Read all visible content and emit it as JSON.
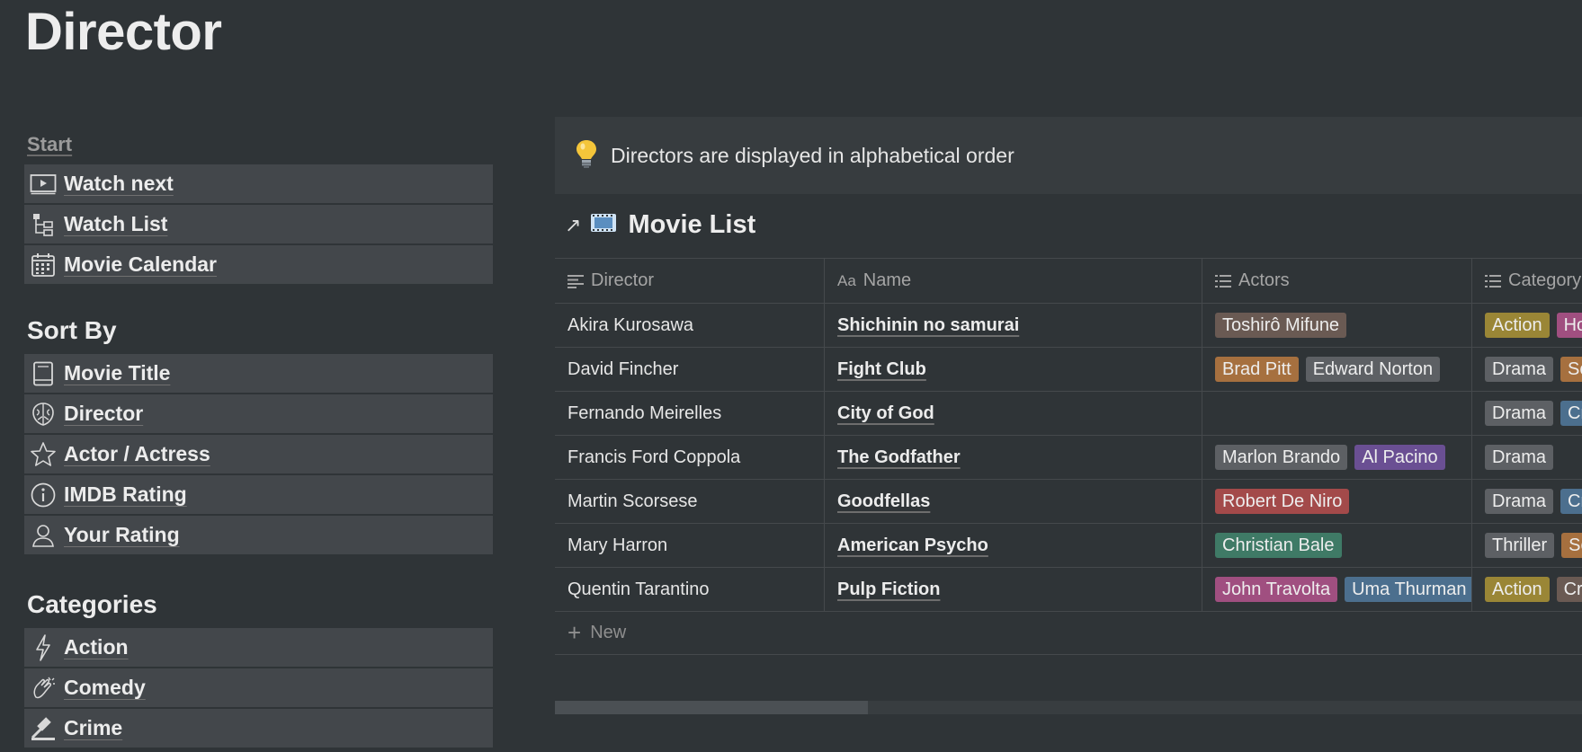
{
  "page": {
    "title": "Director"
  },
  "nav": {
    "start_label": "Start",
    "start_items": [
      {
        "label": "Watch next",
        "icon": "play-screen-icon"
      },
      {
        "label": "Watch List",
        "icon": "tree-list-icon"
      },
      {
        "label": "Movie Calendar",
        "icon": "calendar-icon"
      }
    ],
    "sort_heading": "Sort By",
    "sort_items": [
      {
        "label": "Movie Title",
        "icon": "book-icon"
      },
      {
        "label": "Director",
        "icon": "brain-icon"
      },
      {
        "label": "Actor / Actress",
        "icon": "star-icon"
      },
      {
        "label": "IMDB Rating",
        "icon": "info-icon"
      },
      {
        "label": "Your Rating",
        "icon": "person-icon"
      }
    ],
    "categories_heading": "Categories",
    "category_items": [
      {
        "label": "Action",
        "icon": "lightning-icon"
      },
      {
        "label": "Comedy",
        "icon": "clapping-icon"
      },
      {
        "label": "Crime",
        "icon": "gavel-icon"
      }
    ]
  },
  "callout": {
    "text": "Directors are displayed in alphabetical order"
  },
  "database": {
    "title": "Movie List",
    "columns": {
      "director": "Director",
      "name": "Name",
      "actors": "Actors",
      "category": "Category"
    },
    "rows": [
      {
        "director": "Akira Kurosawa",
        "name": "Shichinin no samurai",
        "actors": [
          {
            "text": "Toshirô Mifune",
            "color": "#6a5a53"
          }
        ],
        "categories": [
          {
            "text": "Action",
            "color": "#9a8636"
          },
          {
            "text": "Horror",
            "color": "#a04f80"
          }
        ]
      },
      {
        "director": "David Fincher",
        "name": "Fight Club",
        "actors": [
          {
            "text": "Brad Pitt",
            "color": "#a6703f"
          },
          {
            "text": "Edward Norton",
            "color": "#5d6064"
          }
        ],
        "categories": [
          {
            "text": "Drama",
            "color": "#5d6064"
          },
          {
            "text": "Sci-Fi",
            "color": "#a6703f"
          }
        ]
      },
      {
        "director": "Fernando Meirelles",
        "name": "City of God",
        "actors": [],
        "categories": [
          {
            "text": "Drama",
            "color": "#5d6064"
          },
          {
            "text": "Crime",
            "color": "#4c6f8e"
          }
        ]
      },
      {
        "director": "Francis Ford Coppola",
        "name": "The Godfather",
        "actors": [
          {
            "text": "Marlon Brando",
            "color": "#5d6064"
          },
          {
            "text": "Al Pacino",
            "color": "#6a4f93"
          }
        ],
        "categories": [
          {
            "text": "Drama",
            "color": "#5d6064"
          }
        ]
      },
      {
        "director": "Martin Scorsese",
        "name": "Goodfellas",
        "actors": [
          {
            "text": "Robert De Niro",
            "color": "#a34a4a"
          }
        ],
        "categories": [
          {
            "text": "Drama",
            "color": "#5d6064"
          },
          {
            "text": "Crime",
            "color": "#4c6f8e"
          }
        ]
      },
      {
        "director": "Mary Harron",
        "name": "American Psycho",
        "actors": [
          {
            "text": "Christian Bale",
            "color": "#3f7a66"
          }
        ],
        "categories": [
          {
            "text": "Thriller",
            "color": "#5d6064"
          },
          {
            "text": "Sci-Fi",
            "color": "#a6703f"
          }
        ]
      },
      {
        "director": "Quentin Tarantino",
        "name": "Pulp Fiction",
        "actors": [
          {
            "text": "John Travolta",
            "color": "#a04f80"
          },
          {
            "text": "Uma Thurman",
            "color": "#4c6f8e"
          }
        ],
        "categories": [
          {
            "text": "Action",
            "color": "#9a8636"
          },
          {
            "text": "Crime",
            "color": "#6a5a53"
          }
        ]
      }
    ],
    "new_label": "New"
  }
}
